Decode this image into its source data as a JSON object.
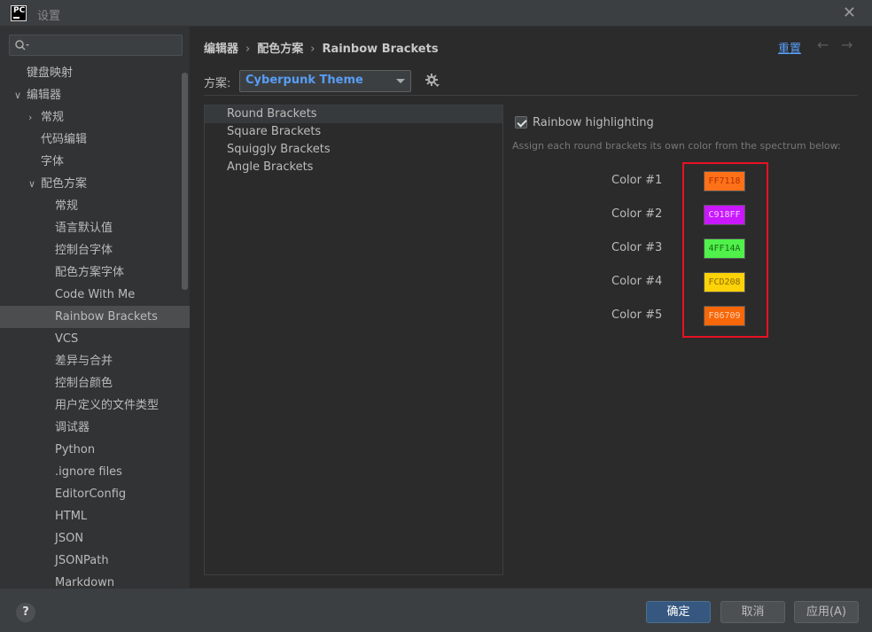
{
  "window": {
    "title": "设置",
    "app_icon_text": "PC"
  },
  "search": {
    "value": ""
  },
  "sidebar": {
    "items": [
      {
        "label": "键盘映射",
        "level": 0,
        "arrow": ""
      },
      {
        "label": "编辑器",
        "level": 0,
        "arrow": "∨"
      },
      {
        "label": "常规",
        "level": 1,
        "arrow": "›"
      },
      {
        "label": "代码编辑",
        "level": 1,
        "arrow": ""
      },
      {
        "label": "字体",
        "level": 1,
        "arrow": ""
      },
      {
        "label": "配色方案",
        "level": 1,
        "arrow": "∨"
      },
      {
        "label": "常规",
        "level": 2,
        "arrow": ""
      },
      {
        "label": "语言默认值",
        "level": 2,
        "arrow": ""
      },
      {
        "label": "控制台字体",
        "level": 2,
        "arrow": ""
      },
      {
        "label": "配色方案字体",
        "level": 2,
        "arrow": ""
      },
      {
        "label": "Code With Me",
        "level": 2,
        "arrow": ""
      },
      {
        "label": "Rainbow Brackets",
        "level": 2,
        "arrow": "",
        "selected": true
      },
      {
        "label": "VCS",
        "level": 2,
        "arrow": ""
      },
      {
        "label": "差异与合并",
        "level": 2,
        "arrow": ""
      },
      {
        "label": "控制台颜色",
        "level": 2,
        "arrow": ""
      },
      {
        "label": "用户定义的文件类型",
        "level": 2,
        "arrow": ""
      },
      {
        "label": "调试器",
        "level": 2,
        "arrow": ""
      },
      {
        "label": "Python",
        "level": 2,
        "arrow": ""
      },
      {
        "label": ".ignore files",
        "level": 2,
        "arrow": ""
      },
      {
        "label": "EditorConfig",
        "level": 2,
        "arrow": ""
      },
      {
        "label": "HTML",
        "level": 2,
        "arrow": ""
      },
      {
        "label": "JSON",
        "level": 2,
        "arrow": ""
      },
      {
        "label": "JSONPath",
        "level": 2,
        "arrow": ""
      },
      {
        "label": "Markdown",
        "level": 2,
        "arrow": ""
      }
    ]
  },
  "header": {
    "breadcrumb": [
      "编辑器",
      "配色方案",
      "Rainbow Brackets"
    ],
    "reset_label": "重置"
  },
  "scheme": {
    "label": "方案:",
    "value": "Cyberpunk Theme"
  },
  "bracket_types": [
    {
      "label": "Round Brackets",
      "selected": true
    },
    {
      "label": "Square Brackets"
    },
    {
      "label": "Squiggly Brackets"
    },
    {
      "label": "Angle Brackets"
    }
  ],
  "rainbow": {
    "checkbox_label": "Rainbow highlighting",
    "checked": true,
    "hint": "Assign each round brackets its own color from the spectrum below:"
  },
  "colors": [
    {
      "label": "Color #1",
      "hex": "FF7118",
      "swatch": "#FF7118",
      "text_color": "#b03000"
    },
    {
      "label": "Color #2",
      "hex": "C918FF",
      "swatch": "#C918FF",
      "text_color": "#f0d0ff"
    },
    {
      "label": "Color #3",
      "hex": "4FF14A",
      "swatch": "#4FF14A",
      "text_color": "#1a6a18"
    },
    {
      "label": "Color #4",
      "hex": "FCD208",
      "swatch": "#FCD208",
      "text_color": "#8a6c00"
    },
    {
      "label": "Color #5",
      "hex": "F86709",
      "swatch": "#F86709",
      "text_color": "#ffd0b0"
    }
  ],
  "footer": {
    "help_label": "?",
    "ok_label": "确定",
    "cancel_label": "取消",
    "apply_label": "应用(A)"
  },
  "theme": {
    "accent": "#589df6",
    "primary_button": "#365880",
    "highlight_border": "#e81123"
  }
}
